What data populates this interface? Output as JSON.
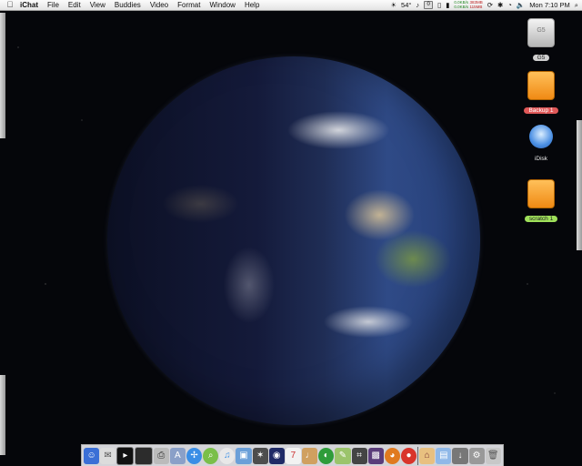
{
  "menubar": {
    "app_name": "iChat",
    "menus": [
      "File",
      "Edit",
      "View",
      "Buddies",
      "Video",
      "Format",
      "Window",
      "Help"
    ],
    "temperature": "54°",
    "number_box": "0",
    "net_top_left": "0.0KB/s",
    "net_top_right": "383MB",
    "net_bottom_left": "0.0KB/s",
    "net_bottom_right": "115MB",
    "clock": "Mon 7:10 PM"
  },
  "desktop_icons": [
    {
      "label": "G5",
      "badge_text": "G5"
    },
    {
      "label": "Backup 1"
    },
    {
      "label": "iDisk"
    },
    {
      "label": "scratch 1"
    }
  ],
  "colors": {
    "backup_label": "#e05858",
    "scratch_label": "#9fe05a",
    "drive_orange": "#f08a14",
    "space": "#05060a"
  },
  "dock_icons": [
    "finder-icon",
    "apple-mail-icon",
    "terminal-icon",
    "monitor-icon",
    "printer-icon",
    "app-icon",
    "safari-icon",
    "search-icon",
    "itunes-icon",
    "iphoto-icon",
    "imovie-icon",
    "dvd-icon",
    "ical-icon",
    "guitar-icon",
    "eclipse-icon",
    "pen-icon",
    "crop-icon",
    "app-icon-2",
    "firefox-icon",
    "tomato-icon",
    "home-folder-icon",
    "documents-icon",
    "downloads-icon",
    "tools-icon",
    "trash-icon"
  ]
}
